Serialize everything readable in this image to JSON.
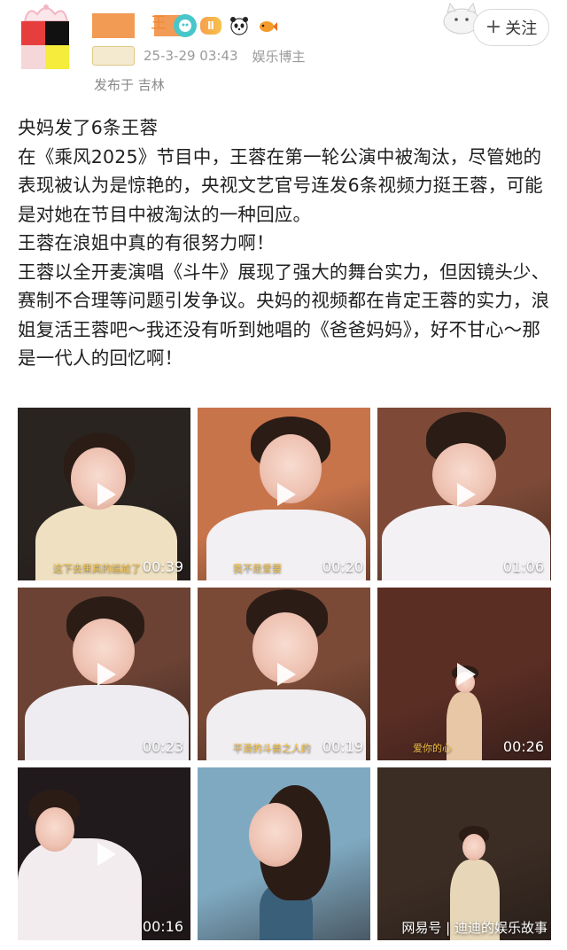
{
  "header": {
    "user_name": "王",
    "level_badge": "Ⅱ",
    "timestamp": "25-3-29 03:43",
    "source": "娱乐博主",
    "location": "发布于 吉林",
    "follow_label": "关注",
    "follow_plus": "+"
  },
  "post": {
    "paragraphs": [
      "央妈发了6条王蓉",
      "在《乘风2025》节目中，王蓉在第一轮公演中被淘汰，尽管她的表现被认为是惊艳的，央视文艺官号连发6条视频力挺王蓉，可能是对她在节目中被淘汰的一种回应。",
      "王蓉在浪姐中真的有很努力啊！",
      "王蓉以全开麦演唱《斗牛》展现了强大的舞台实力，但因镜头少、赛制不合理等问题引发争议。央妈的视频都在肯定王蓉的实力，浪姐复活王蓉吧～我还没有听到她唱的《爸爸妈妈》，好不甘心～那是一代人的回忆啊！"
    ]
  },
  "media": [
    {
      "duration": "00:39",
      "caption": "这下去果真的尴尬了",
      "bg": "#2a2421",
      "accent": "#efe0c2"
    },
    {
      "duration": "00:20",
      "caption": "我不是爱要",
      "bg": "#c8744b",
      "accent": "#f2f0f3"
    },
    {
      "duration": "01:06",
      "caption": "",
      "bg": "#7e4a37",
      "accent": "#f4f1f4"
    },
    {
      "duration": "00:23",
      "caption": "",
      "bg": "#6b4234",
      "accent": "#eeecf1"
    },
    {
      "duration": "00:19",
      "caption": "平滑的斗兽之人的",
      "bg": "#7a4a36",
      "accent": "#f1eef2"
    },
    {
      "duration": "00:26",
      "caption": "爱你的心",
      "bg": "#5b2e24",
      "accent": "#e7c7a6"
    },
    {
      "duration": "00:16",
      "caption": "",
      "bg": "#211a1c",
      "accent": "#f3ecef"
    },
    {
      "duration": "",
      "caption": "",
      "bg": "#7fa9c1",
      "accent": "#3a5f79"
    },
    {
      "duration": "",
      "caption": "",
      "bg": "#3b2d24",
      "accent": "#e7d7b8"
    }
  ],
  "watermark": "网易号 | 迪迪的娱乐故事"
}
